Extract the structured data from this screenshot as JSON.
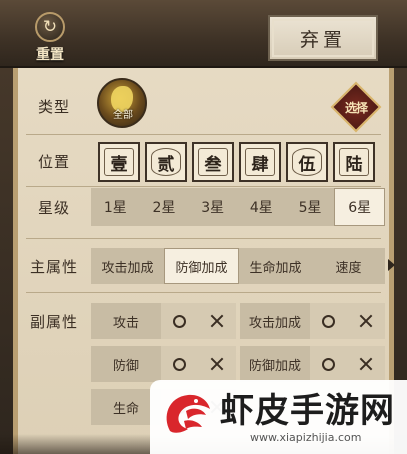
{
  "header": {
    "reset_label": "重置",
    "reset_icon": "refresh-icon",
    "discard_label": "弃置"
  },
  "type_row": {
    "label": "类型",
    "selected_tag": "全部",
    "choose_label": "选择"
  },
  "position_row": {
    "label": "位置",
    "slots": [
      "壹",
      "贰",
      "叁",
      "肆",
      "伍",
      "陆"
    ]
  },
  "star_row": {
    "label": "星级",
    "options": [
      "1星",
      "2星",
      "3星",
      "4星",
      "5星",
      "6星"
    ],
    "selected": "6星"
  },
  "main_attr_row": {
    "label": "主属性",
    "options": [
      "攻击加成",
      "防御加成",
      "生命加成",
      "速度"
    ],
    "selected": "防御加成"
  },
  "sub_attr_row": {
    "label": "副属性",
    "items": [
      "攻击",
      "攻击加成",
      "防御",
      "防御加成",
      "生命"
    ]
  },
  "watermark": {
    "title": "虾皮手游网",
    "url": "www.xiapizhijia.com"
  },
  "colors": {
    "parchment": "#e6dac3",
    "frame_dark": "#3a2f25",
    "selected_bg": "#f6efe0",
    "bar_bg": "#c8bca4"
  }
}
